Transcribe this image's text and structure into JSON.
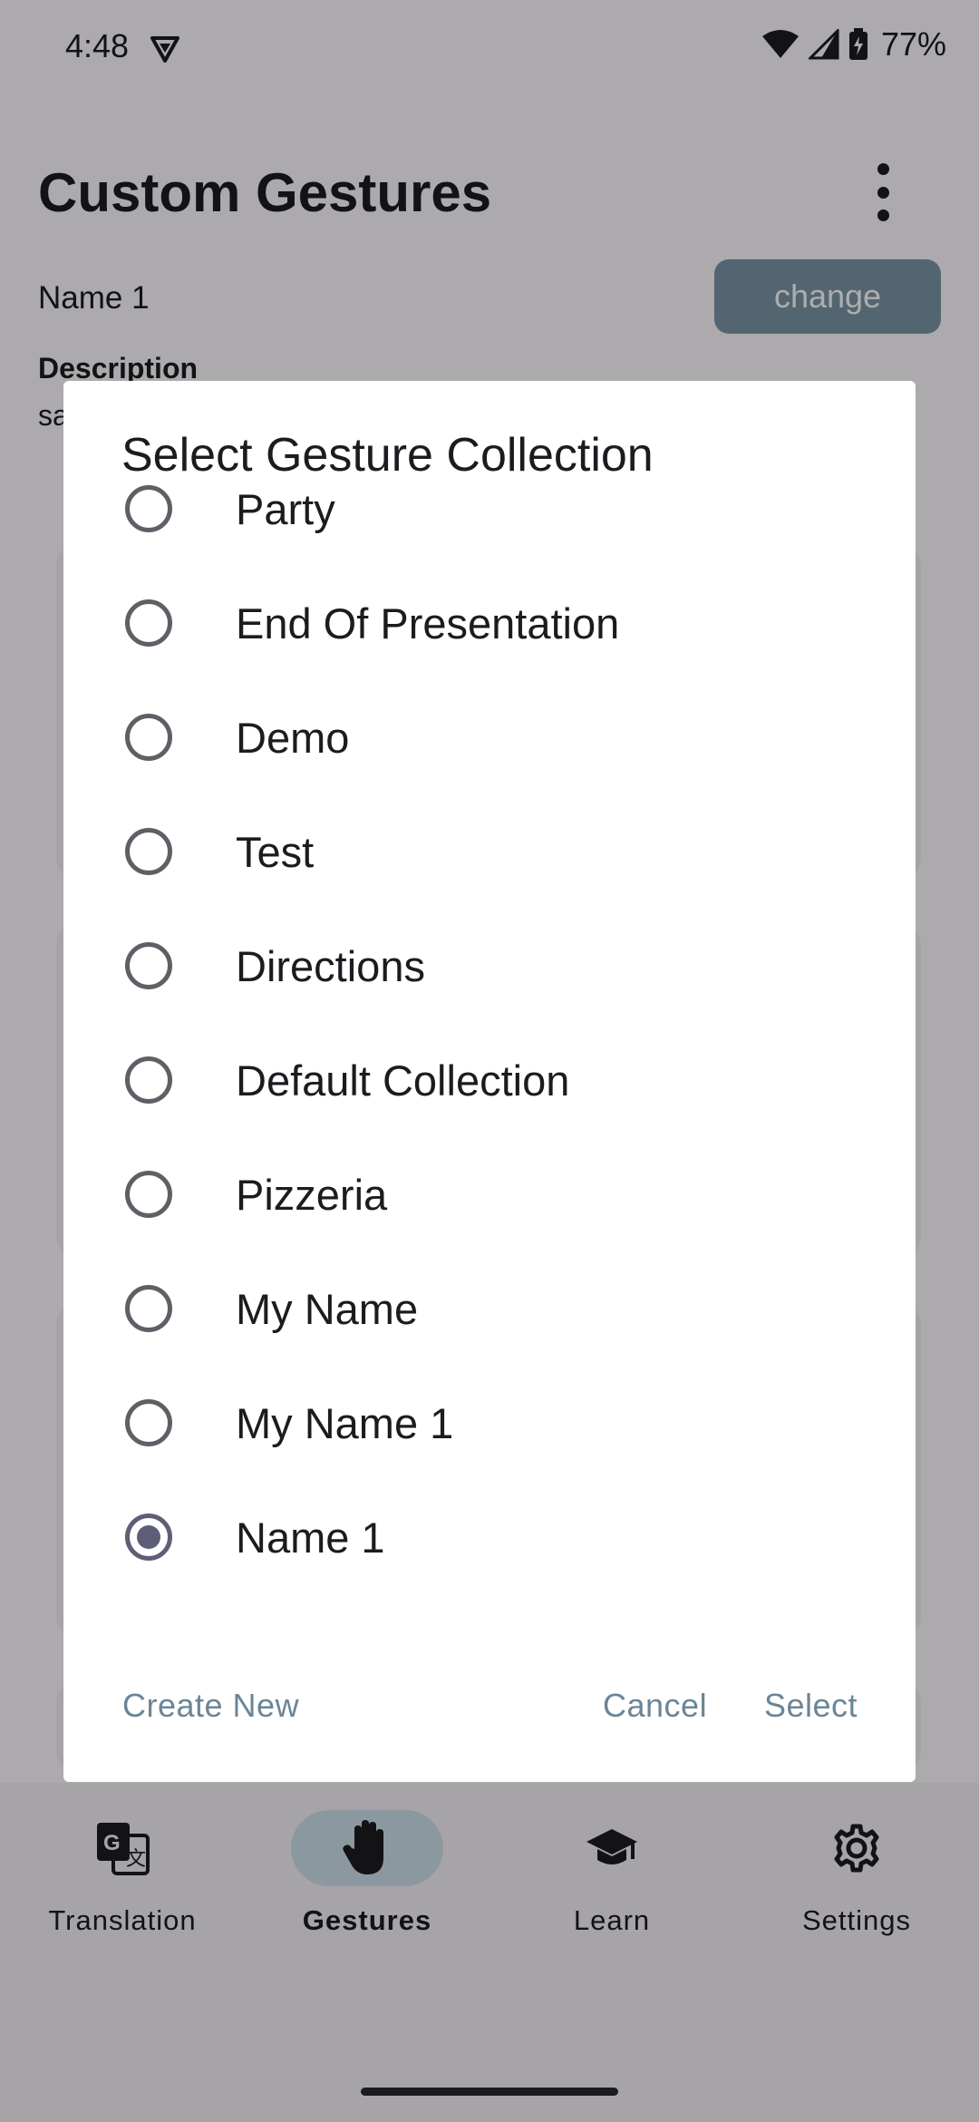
{
  "status_bar": {
    "time": "4:48",
    "battery": "77%"
  },
  "page": {
    "title": "Custom Gestures",
    "collection_name": "Name 1",
    "change_label": "change",
    "description_label": "Description",
    "description_value": "sa"
  },
  "dialog": {
    "title": "Select Gesture Collection",
    "options": [
      {
        "label": "Party",
        "selected": false
      },
      {
        "label": "End Of Presentation",
        "selected": false
      },
      {
        "label": "Demo",
        "selected": false
      },
      {
        "label": "Test",
        "selected": false
      },
      {
        "label": "Directions",
        "selected": false
      },
      {
        "label": "Default Collection",
        "selected": false
      },
      {
        "label": "Pizzeria",
        "selected": false
      },
      {
        "label": "My Name",
        "selected": false
      },
      {
        "label": "My Name 1",
        "selected": false
      },
      {
        "label": "Name 1",
        "selected": true
      }
    ],
    "create_new_label": "Create New",
    "cancel_label": "Cancel",
    "select_label": "Select"
  },
  "bottom_nav": {
    "items": [
      {
        "label": "Translation",
        "icon": "translate-icon",
        "active": false
      },
      {
        "label": "Gestures",
        "icon": "hand-icon",
        "active": true
      },
      {
        "label": "Learn",
        "icon": "graduation-cap-icon",
        "active": false
      },
      {
        "label": "Settings",
        "icon": "gear-icon",
        "active": false
      }
    ]
  },
  "colors": {
    "accent": "#6b8597",
    "change_button": "#7b95a7",
    "nav_active_indicator": "#cfe0ea",
    "radio_selected": "#5e5e76"
  }
}
